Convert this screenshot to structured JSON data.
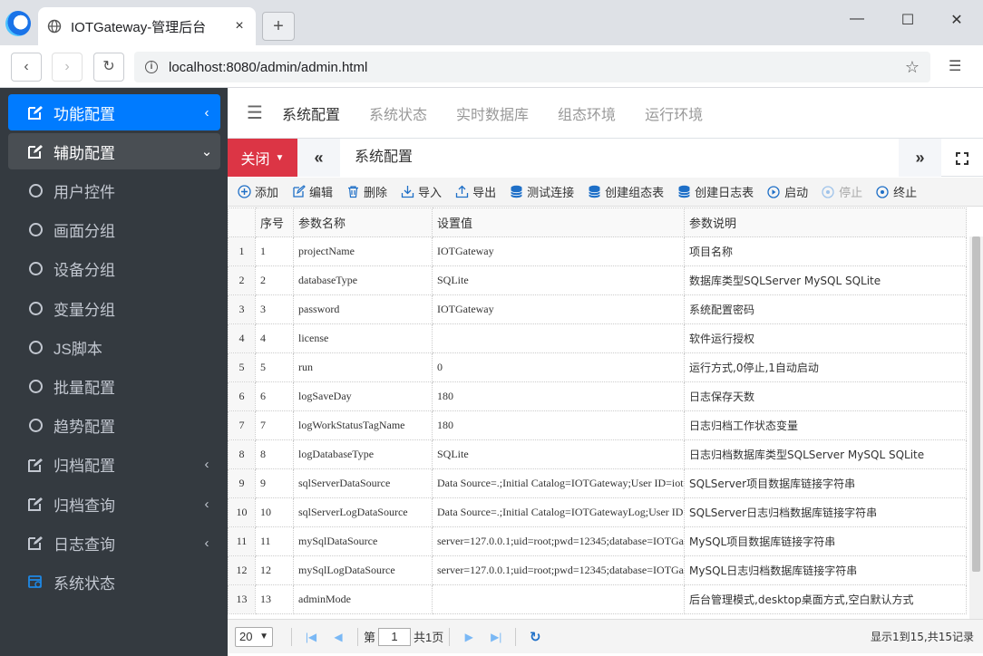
{
  "browser": {
    "tab_title": "IOTGateway-管理后台",
    "tab_close": "×",
    "new_tab": "+",
    "url": "localhost:8080/admin/admin.html"
  },
  "sidebar": {
    "items": [
      {
        "label": "功能配置",
        "icon": "edit-icon",
        "arrow": "‹",
        "state": "active"
      },
      {
        "label": "辅助配置",
        "icon": "edit-icon",
        "arrow": "⌄",
        "state": "open"
      },
      {
        "label": "用户控件",
        "icon": "circle-icon"
      },
      {
        "label": "画面分组",
        "icon": "circle-icon"
      },
      {
        "label": "设备分组",
        "icon": "circle-icon"
      },
      {
        "label": "变量分组",
        "icon": "circle-icon"
      },
      {
        "label": "JS脚本",
        "icon": "circle-icon"
      },
      {
        "label": "批量配置",
        "icon": "circle-icon"
      },
      {
        "label": "趋势配置",
        "icon": "circle-icon"
      },
      {
        "label": "归档配置",
        "icon": "edit-icon",
        "arrow": "‹"
      },
      {
        "label": "归档查询",
        "icon": "edit-icon",
        "arrow": "‹"
      },
      {
        "label": "日志查询",
        "icon": "edit-icon",
        "arrow": "‹"
      },
      {
        "label": "系统状态",
        "icon": "calendar-icon"
      }
    ]
  },
  "topnav": {
    "links": [
      "系统配置",
      "系统状态",
      "实时数据库",
      "组态环境",
      "运行环境"
    ]
  },
  "tabs": {
    "close_label": "关闭",
    "prev": "«",
    "next": "»",
    "current": "系统配置"
  },
  "toolbar": {
    "add": "添加",
    "edit": "编辑",
    "delete": "删除",
    "import": "导入",
    "export": "导出",
    "test_connection": "测试连接",
    "create_config_table": "创建组态表",
    "create_log_table": "创建日志表",
    "start": "启动",
    "stop": "停止",
    "terminate": "终止"
  },
  "grid": {
    "headers": [
      "序号",
      "参数名称",
      "设置值",
      "参数说明"
    ],
    "rows": [
      {
        "rn": "1",
        "seq": "1",
        "name": "projectName",
        "value": "IOTGateway",
        "desc": "项目名称"
      },
      {
        "rn": "2",
        "seq": "2",
        "name": "databaseType",
        "value": "SQLite",
        "desc": "数据库类型SQLServer MySQL SQLite"
      },
      {
        "rn": "3",
        "seq": "3",
        "name": "password",
        "value": "IOTGateway",
        "desc": "系统配置密码"
      },
      {
        "rn": "4",
        "seq": "4",
        "name": "license",
        "value": "",
        "desc": "软件运行授权"
      },
      {
        "rn": "5",
        "seq": "5",
        "name": "run",
        "value": "0",
        "desc": "运行方式,0停止,1自动启动"
      },
      {
        "rn": "6",
        "seq": "6",
        "name": "logSaveDay",
        "value": "180",
        "desc": "日志保存天数"
      },
      {
        "rn": "7",
        "seq": "7",
        "name": "logWorkStatusTagName",
        "value": "180",
        "desc": "日志归档工作状态变量"
      },
      {
        "rn": "8",
        "seq": "8",
        "name": "logDatabaseType",
        "value": "SQLite",
        "desc": "日志归档数据库类型SQLServer MySQL SQLite"
      },
      {
        "rn": "9",
        "seq": "9",
        "name": "sqlServerDataSource",
        "value": "Data Source=.;Initial Catalog=IOTGateway;User ID=iot",
        "desc": "SQLServer项目数据库链接字符串"
      },
      {
        "rn": "10",
        "seq": "10",
        "name": "sqlServerLogDataSource",
        "value": "Data Source=.;Initial Catalog=IOTGatewayLog;User ID",
        "desc": "SQLServer日志归档数据库链接字符串"
      },
      {
        "rn": "11",
        "seq": "11",
        "name": "mySqlDataSource",
        "value": "server=127.0.0.1;uid=root;pwd=12345;database=IOTGa",
        "desc": "MySQL项目数据库链接字符串"
      },
      {
        "rn": "12",
        "seq": "12",
        "name": "mySqlLogDataSource",
        "value": "server=127.0.0.1;uid=root;pwd=12345;database=IOTGa",
        "desc": "MySQL日志归档数据库链接字符串"
      },
      {
        "rn": "13",
        "seq": "13",
        "name": "adminMode",
        "value": "",
        "desc": "后台管理模式,desktop桌面方式,空白默认方式"
      }
    ]
  },
  "pager": {
    "page_size": "20",
    "page_prefix": "第",
    "page_number": "1",
    "page_suffix": "共1页",
    "info": "显示1到15,共15记录"
  },
  "colors": {
    "sidebar_bg": "#343a40",
    "active": "#007bff",
    "close_btn": "#dc3545",
    "db_icon": "#1e6fc7"
  }
}
